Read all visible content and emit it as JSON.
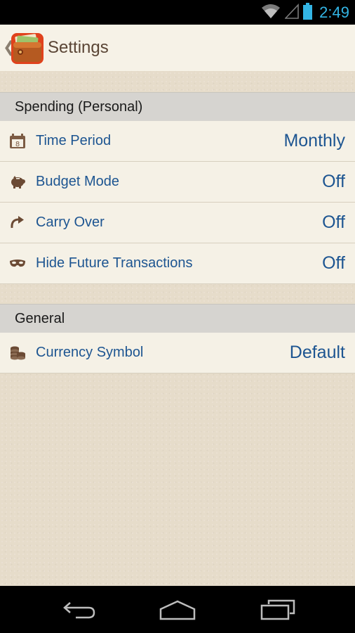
{
  "status_bar": {
    "time": "2:49",
    "icons": [
      "wifi-icon",
      "signal-icon",
      "battery-icon"
    ]
  },
  "action_bar": {
    "title": "Settings",
    "icon": "wallet-app-icon"
  },
  "sections": [
    {
      "header": "Spending (Personal)",
      "rows": [
        {
          "icon": "calendar-icon",
          "label": "Time Period",
          "value": "Monthly"
        },
        {
          "icon": "piggy-bank-icon",
          "label": "Budget Mode",
          "value": "Off"
        },
        {
          "icon": "redo-arrow-icon",
          "label": "Carry Over",
          "value": "Off"
        },
        {
          "icon": "mask-icon",
          "label": "Hide Future Transactions",
          "value": "Off"
        }
      ]
    },
    {
      "header": "General",
      "rows": [
        {
          "icon": "coins-icon",
          "label": "Currency Symbol",
          "value": "Default"
        }
      ]
    }
  ],
  "nav_bar": {
    "buttons": [
      "back-icon",
      "home-icon",
      "recents-icon"
    ]
  },
  "colors": {
    "accent": "#1d5591",
    "status": "#33b5e5",
    "background": "#e6dcca"
  },
  "calendar_day": "8"
}
